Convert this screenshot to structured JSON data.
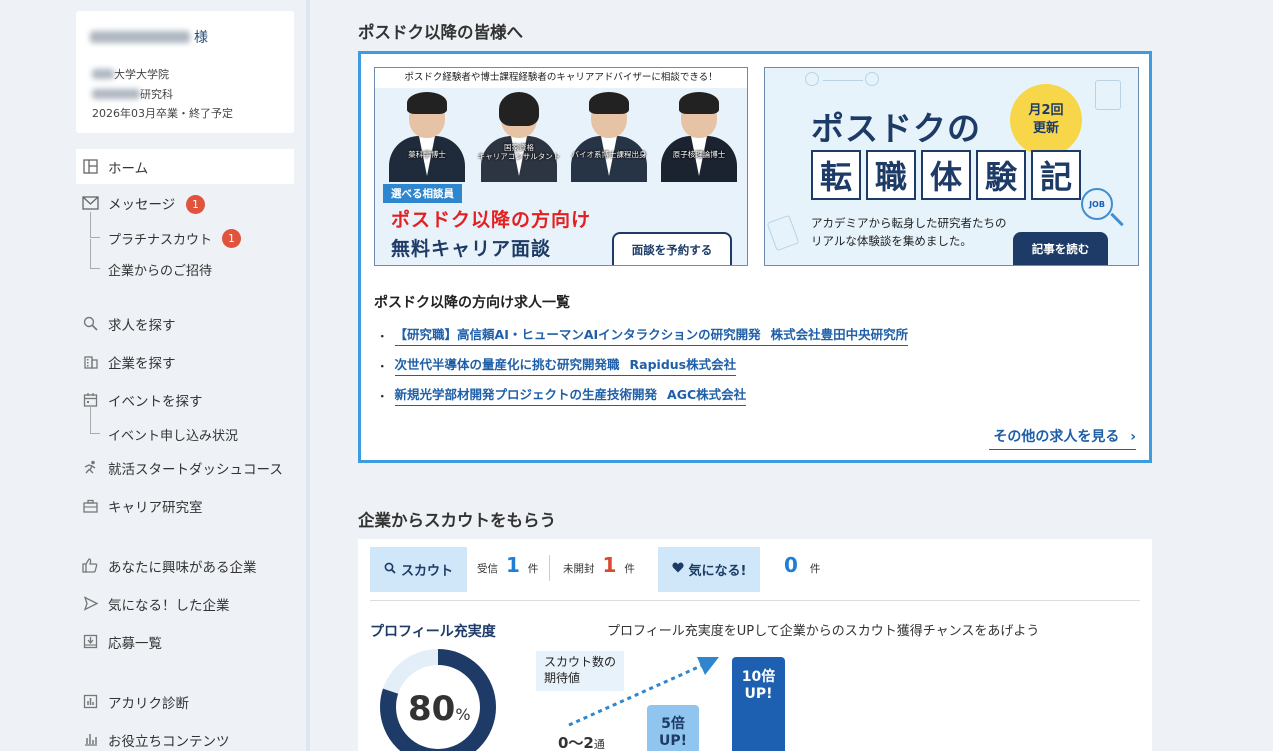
{
  "user": {
    "suffix": "様",
    "university": "大学大学院",
    "department": "研究科",
    "graduation": "2026年03月卒業・終了予定"
  },
  "nav": {
    "home": "ホーム",
    "messages": "メッセージ",
    "messages_badge": "1",
    "platinum_scout": "プラチナスカウト",
    "platinum_badge": "1",
    "invitations": "企業からのご招待",
    "find_jobs": "求人を探す",
    "find_companies": "企業を探す",
    "find_events": "イベントを探す",
    "event_status": "イベント申し込み状況",
    "startdash": "就活スタートダッシュコース",
    "career_lab": "キャリア研究室",
    "interested_companies": "あなたに興味がある企業",
    "liked_companies": "気になる！した企業",
    "applications": "応募一覧",
    "diagnosis": "アカリク診断",
    "useful_contents": "お役立ちコンテンツ"
  },
  "postdoc": {
    "section_title": "ポスドク以降の皆様へ",
    "banner_left": {
      "top_text": "ポスドク経験者や博士課程経験者のキャリアアドバイザーに相談できる！",
      "people": [
        "薬科学博士",
        "国家資格\nキャリアコンサルタント",
        "バイオ系博士課程出身",
        "原子核理論博士"
      ],
      "tag": "選べる相談員",
      "headline1": "ポスドク以降の方向け",
      "headline2": "無料キャリア面談",
      "button": "面談を予約する"
    },
    "banner_right": {
      "title": "ポスドクの",
      "circle_line1": "月2回",
      "circle_line2": "更新",
      "kanji": [
        "転",
        "職",
        "体",
        "験",
        "記"
      ],
      "sub1": "アカデミアから転身した研究者たちの",
      "sub2": "リアルな体験談を集めました。",
      "button": "記事を読む",
      "job_icon": "JOB"
    },
    "jobs_title": "ポスドク以降の方向け求人一覧",
    "jobs": [
      {
        "title": "【研究職】高信頼AI・ヒューマンAIインタラクションの研究開発",
        "company": "株式会社豊田中央研究所"
      },
      {
        "title": "次世代半導体の量産化に挑む研究開発職",
        "company": "Rapidus株式会社"
      },
      {
        "title": "新規光学部材開発プロジェクトの生産技術開発",
        "company": "AGC株式会社"
      }
    ],
    "bullet": "・",
    "more": "その他の求人を見る"
  },
  "scout": {
    "section_title": "企業からスカウトをもらう",
    "scout_tab": "スカウト",
    "received_label": "受信",
    "received_count": "1",
    "unopened_label": "未開封",
    "unopened_count": "1",
    "unit": "件",
    "like_tab": "気になる!",
    "like_count": "0",
    "profile_title": "プロフィール充実度",
    "profile_percent_value": 80,
    "profile_percent": "80",
    "percent_sign": "%",
    "profile_hint": "プロフィール充実度をUPして企業からのスカウト獲得チャンスをあげよう",
    "expect_line1": "スカウト数の",
    "expect_line2": "期待値",
    "base_value": "0〜2",
    "base_unit": "通",
    "bar5_line1": "5倍",
    "bar5_line2": "UP!",
    "bar10_line1": "10倍",
    "bar10_line2": "UP!"
  },
  "colors": {
    "accent": "#3f9be0",
    "navy": "#1d3b66",
    "badge": "#e0533d",
    "red_count": "#d9482f",
    "blue_count": "#1f7fd6"
  }
}
